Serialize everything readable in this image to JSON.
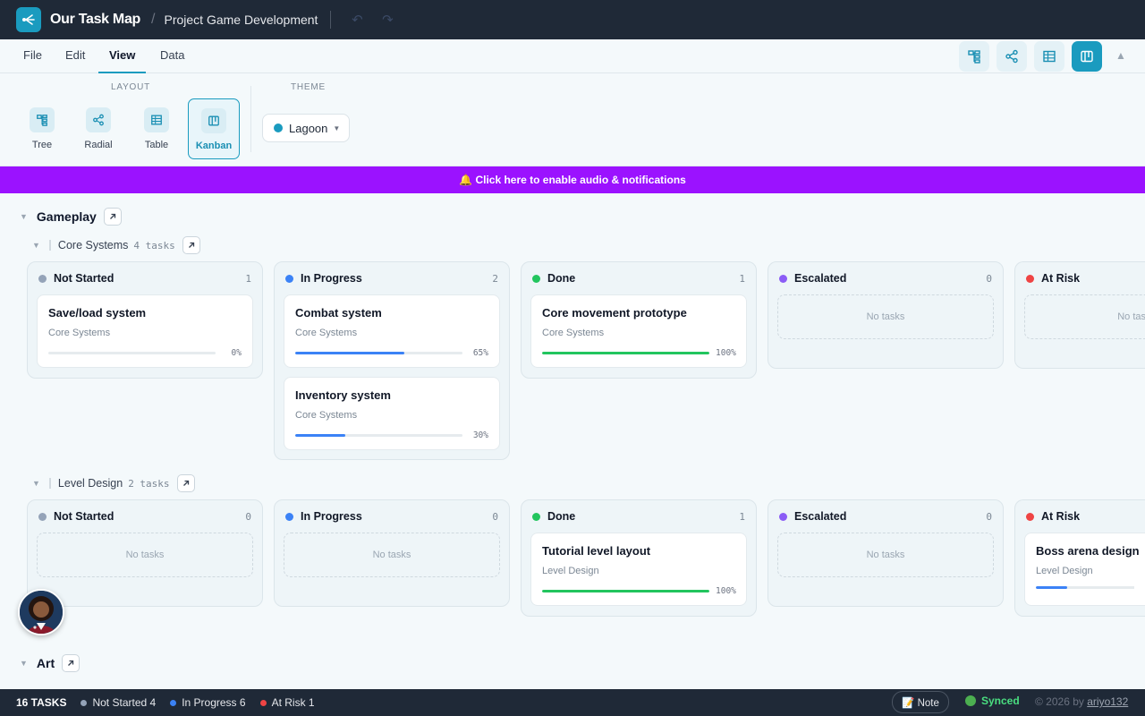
{
  "topbar": {
    "app_title": "Our Task Map",
    "separator": "/",
    "project": "Project Game Development"
  },
  "menu": {
    "file": "File",
    "edit": "Edit",
    "view": "View",
    "data": "Data"
  },
  "toolbar": {
    "layout_label": "LAYOUT",
    "theme_label": "THEME",
    "layouts": {
      "tree": "Tree",
      "radial": "Radial",
      "table": "Table",
      "kanban": "Kanban"
    },
    "theme_value": "Lagoon"
  },
  "banner": "🔔 Click here to enable audio & notifications",
  "groups": [
    {
      "title": "Gameplay",
      "subgroups": [
        {
          "title": "Core Systems",
          "count": "4 tasks",
          "columns": [
            {
              "name": "Not Started",
              "count": "1",
              "cards": [
                {
                  "title": "Save/load system",
                  "sub": "Core Systems",
                  "pct": "0%",
                  "progress": 0
                }
              ]
            },
            {
              "name": "In Progress",
              "count": "2",
              "cards": [
                {
                  "title": "Combat system",
                  "sub": "Core Systems",
                  "pct": "65%",
                  "progress": 65
                },
                {
                  "title": "Inventory system",
                  "sub": "Core Systems",
                  "pct": "30%",
                  "progress": 30
                }
              ]
            },
            {
              "name": "Done",
              "count": "1",
              "cards": [
                {
                  "title": "Core movement prototype",
                  "sub": "Core Systems",
                  "pct": "100%",
                  "progress": 100
                }
              ]
            },
            {
              "name": "Escalated",
              "count": "0",
              "empty": "No tasks"
            },
            {
              "name": "At Risk",
              "count": "",
              "empty": "No tasks"
            }
          ]
        },
        {
          "title": "Level Design",
          "count": "2 tasks",
          "columns": [
            {
              "name": "Not Started",
              "count": "0",
              "empty": "No tasks"
            },
            {
              "name": "In Progress",
              "count": "0",
              "empty": "No tasks"
            },
            {
              "name": "Done",
              "count": "1",
              "cards": [
                {
                  "title": "Tutorial level layout",
                  "sub": "Level Design",
                  "pct": "100%",
                  "progress": 100
                }
              ]
            },
            {
              "name": "Escalated",
              "count": "0",
              "empty": "No tasks"
            },
            {
              "name": "At Risk",
              "count": "",
              "cards": [
                {
                  "title": "Boss arena design",
                  "sub": "Level Design",
                  "progress": 15
                }
              ]
            }
          ]
        }
      ]
    },
    {
      "title": "Art"
    }
  ],
  "status_colors": {
    "not_started": "#94a3b8",
    "in_progress": "#3b82f6",
    "done": "#22c55e",
    "escalated": "#8b5cf6",
    "at_risk": "#ef4444"
  },
  "accent": "#1a9bbf",
  "statusbar": {
    "total": "16 TASKS",
    "not_started": "Not Started 4",
    "in_progress": "In Progress 6",
    "at_risk": "At Risk 1",
    "note": "📝 Note",
    "synced": "Synced",
    "copyright": "© 2026 by",
    "author": "ariyo132"
  }
}
